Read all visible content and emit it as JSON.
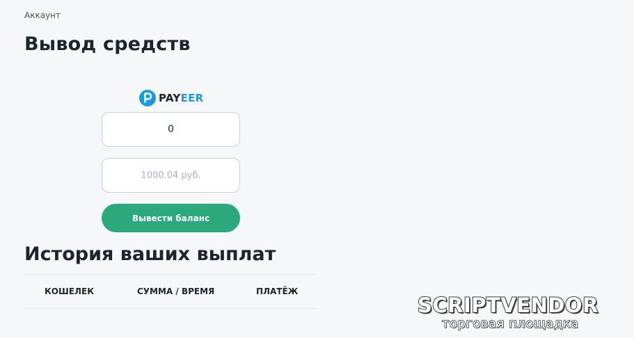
{
  "breadcrumb": "Аккаунт",
  "page_title": "Вывод средств",
  "payment_method": {
    "icon": "payeer-logo-icon",
    "name_part1": "PAY",
    "name_part2": "EER",
    "brand_color": "#1a9be0"
  },
  "form": {
    "amount_value": "0",
    "balance_placeholder": "1000.04 руб.",
    "submit_label": "Вывести баланс",
    "submit_color": "#2ca97c"
  },
  "history": {
    "title": "История ваших выплат",
    "columns": [
      "КОШЕЛЕК",
      "СУММА / ВРЕМЯ",
      "ПЛАТЁЖ"
    ]
  },
  "watermark": {
    "main": "SCRIPTVENDOR",
    "sub": "торговая площадка"
  }
}
